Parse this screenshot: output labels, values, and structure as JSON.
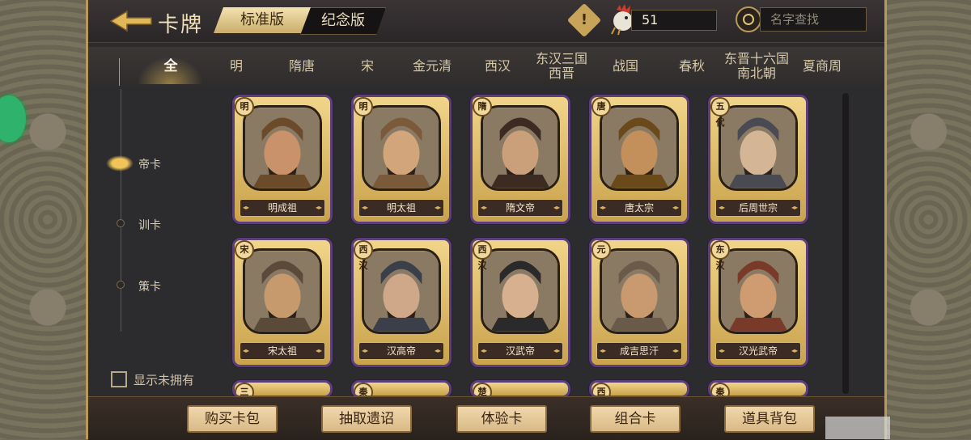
{
  "header": {
    "title": "卡牌",
    "version_tabs": [
      "标准版",
      "纪念版"
    ],
    "currency_value": "51",
    "search_placeholder": "名字查找"
  },
  "era_tabs": [
    {
      "label": "全",
      "active": true
    },
    {
      "label": "明"
    },
    {
      "label": "隋唐"
    },
    {
      "label": "宋"
    },
    {
      "label": "金元清"
    },
    {
      "label": "西汉"
    },
    {
      "label": "东汉三国西晋"
    },
    {
      "label": "战国"
    },
    {
      "label": "春秋"
    },
    {
      "label": "东晋十六国南北朝"
    },
    {
      "label": "夏商周"
    }
  ],
  "filters": {
    "items": [
      "帝卡",
      "训卡",
      "策卡"
    ],
    "active": "帝卡",
    "show_unowned_label": "显示未拥有"
  },
  "cards": [
    {
      "name": "明成祖",
      "era": "明",
      "colors": [
        "#6b4b2a",
        "#c9926a"
      ]
    },
    {
      "name": "明太祖",
      "era": "明",
      "colors": [
        "#7a5a3a",
        "#d2a67a"
      ]
    },
    {
      "name": "隋文帝",
      "era": "隋",
      "colors": [
        "#3b2b22",
        "#caa07a"
      ]
    },
    {
      "name": "唐太宗",
      "era": "唐",
      "colors": [
        "#6a4a1a",
        "#c38f5a"
      ]
    },
    {
      "name": "后周世宗",
      "era": "五代",
      "colors": [
        "#4a4a52",
        "#d4b696"
      ]
    },
    {
      "name": "宋太祖",
      "era": "宋",
      "colors": [
        "#5a4a3a",
        "#c79a6e"
      ]
    },
    {
      "name": "汉高帝",
      "era": "西汉",
      "colors": [
        "#3a3f4a",
        "#cfa88a"
      ]
    },
    {
      "name": "汉武帝",
      "era": "西汉",
      "colors": [
        "#2a2a2a",
        "#d7b090"
      ]
    },
    {
      "name": "成吉思汗",
      "era": "元",
      "colors": [
        "#6a5a4a",
        "#c99a70"
      ]
    },
    {
      "name": "汉光武帝",
      "era": "东汉",
      "colors": [
        "#7a3a2a",
        "#cf9c72"
      ]
    }
  ],
  "partial_badges": [
    "三",
    "秦",
    "楚",
    "西",
    "秦"
  ],
  "bottom_buttons": [
    "购买卡包",
    "抽取遗诏",
    "体验卡",
    "组合卡",
    "道具背包"
  ],
  "colors": {
    "panel_bg": "#2c2b2d",
    "gold": "#d9b461",
    "card_border": "#5b3f7a"
  }
}
